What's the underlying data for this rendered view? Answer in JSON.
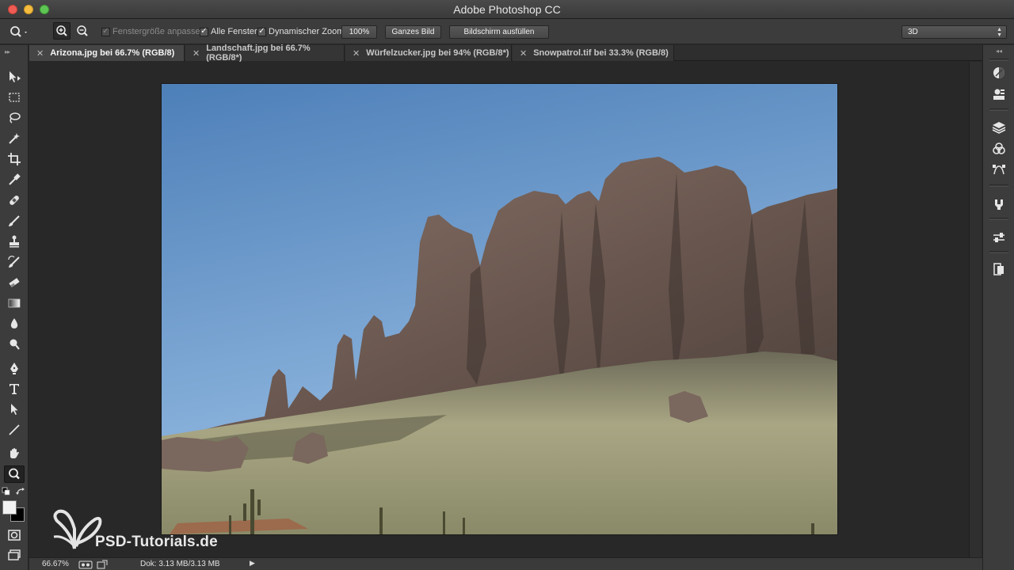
{
  "window": {
    "title": "Adobe Photoshop CC"
  },
  "options_bar": {
    "fenster_label": "Fenstergröße anpassen",
    "alle_fenster_label": "Alle Fenster",
    "dyn_zoom_label": "Dynamischer Zoom",
    "btn_100": "100%",
    "btn_ganzes_bild": "Ganzes Bild",
    "btn_bildschirm": "Bildschirm ausfüllen",
    "workspace_select": "3D",
    "fenster_checked": true,
    "alle_fenster_checked": true,
    "dyn_zoom_checked": true
  },
  "tabs": [
    {
      "label": "Arizona.jpg bei 66.7% (RGB/8)",
      "active": true
    },
    {
      "label": "Landschaft.jpg bei 66.7% (RGB/8*)",
      "active": false
    },
    {
      "label": "Würfelzucker.jpg bei 94% (RGB/8*)",
      "active": false
    },
    {
      "label": "Snowpatrol.tif bei 33.3% (RGB/8)",
      "active": false
    }
  ],
  "status": {
    "zoom": "66.67%",
    "doc": "Dok: 3.13 MB/3.13 MB"
  },
  "watermark": {
    "text": "PSD-Tutorials.de"
  },
  "tools": [
    "move-tool",
    "marquee-tool",
    "lasso-tool",
    "magic-wand-tool",
    "crop-tool",
    "eyedropper-tool",
    "healing-brush-tool",
    "brush-tool",
    "clone-stamp-tool",
    "history-brush-tool",
    "eraser-tool",
    "gradient-tool",
    "blur-tool",
    "dodge-tool",
    "pen-tool",
    "type-tool",
    "path-selection-tool",
    "line-tool",
    "hand-tool",
    "zoom-tool"
  ],
  "colors": {
    "foreground": "#f2f2f2",
    "background": "#000000",
    "sky_top": "#4d7fb8",
    "sky_bottom": "#9cc1e6",
    "rock": "#6e5a52",
    "ground": "#b0ad8a"
  }
}
